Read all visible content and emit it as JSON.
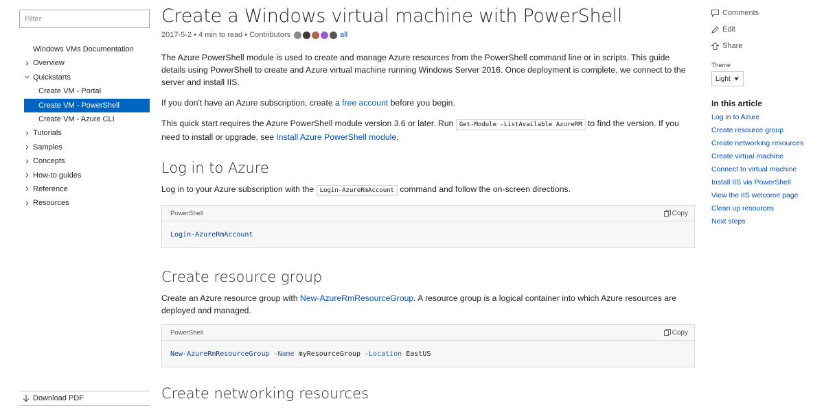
{
  "sidebar": {
    "filter_placeholder": "Filter",
    "items": [
      {
        "label": "Windows VMs Documentation",
        "level": 0,
        "chevron": "none"
      },
      {
        "label": "Overview",
        "level": 0,
        "chevron": "right"
      },
      {
        "label": "Quickstarts",
        "level": 0,
        "chevron": "down"
      },
      {
        "label": "Create VM - Portal",
        "level": 1,
        "chevron": "none"
      },
      {
        "label": "Create VM - PowerShell",
        "level": 1,
        "chevron": "none",
        "active": true
      },
      {
        "label": "Create VM - Azure CLI",
        "level": 1,
        "chevron": "none"
      },
      {
        "label": "Tutorials",
        "level": 0,
        "chevron": "right"
      },
      {
        "label": "Samples",
        "level": 0,
        "chevron": "right"
      },
      {
        "label": "Concepts",
        "level": 0,
        "chevron": "right"
      },
      {
        "label": "How-to guides",
        "level": 0,
        "chevron": "right"
      },
      {
        "label": "Reference",
        "level": 0,
        "chevron": "right"
      },
      {
        "label": "Resources",
        "level": 0,
        "chevron": "right"
      }
    ],
    "download_pdf": "Download PDF"
  },
  "article": {
    "title": "Create a Windows virtual machine with PowerShell",
    "meta": {
      "date": "2017-5-2",
      "read_time": "4 min to read",
      "contributors_label": "Contributors",
      "all_link": "all"
    },
    "intro": {
      "p1": "The Azure PowerShell module is used to create and manage Azure resources from the PowerShell command line or in scripts. This guide details using PowerShell to create and Azure virtual machine running Windows Server 2016. Once deployment is complete, we connect to the server and install IIS.",
      "p2_before": "If you don't have an Azure subscription, create a ",
      "p2_link": "free account",
      "p2_after": " before you begin.",
      "p3_before": "This quick start requires the Azure PowerShell module version 3.6 or later. Run ",
      "p3_code": "Get-Module -ListAvailable AzureRM",
      "p3_mid": " to find the version. If you need to install or upgrade, see ",
      "p3_link": "Install Azure PowerShell module",
      "p3_after": "."
    },
    "section_login": {
      "heading": "Log in to Azure",
      "text_before": "Log in to your Azure subscription with the ",
      "text_code": "Login-AzureRmAccount",
      "text_after": " command and follow the on-screen directions.",
      "code_lang": "PowerShell",
      "copy_label": "Copy",
      "code": "Login-AzureRmAccount"
    },
    "section_rg": {
      "heading": "Create resource group",
      "text_before": "Create an Azure resource group with ",
      "text_link": "New-AzureRmResourceGroup",
      "text_after": ". A resource group is a logical container into which Azure resources are deployed and managed.",
      "code_lang": "PowerShell",
      "copy_label": "Copy",
      "code_cmd": "New-AzureRmResourceGroup",
      "code_p1": "-Name",
      "code_v1": "myResourceGroup",
      "code_p2": "-Location",
      "code_v2": "EastUS"
    },
    "section_net": {
      "heading": "Create networking resources"
    }
  },
  "rail": {
    "comments": "Comments",
    "edit": "Edit",
    "share": "Share",
    "theme_label": "Theme",
    "theme_value": "Light",
    "in_this_article": "In this article",
    "links": [
      "Log in to Azure",
      "Create resource group",
      "Create networking resources",
      "Create virtual machine",
      "Connect to virtual machine",
      "Install IIS via PowerShell",
      "View the IIS welcome page",
      "Clean up resources",
      "Next steps"
    ]
  },
  "colors": {
    "accent": "#0065c1",
    "link": "#0050c5"
  },
  "avatar_colors": [
    "#8a8a8a",
    "#3a3a3a",
    "#b5654a",
    "#9b59d0",
    "#555555"
  ]
}
